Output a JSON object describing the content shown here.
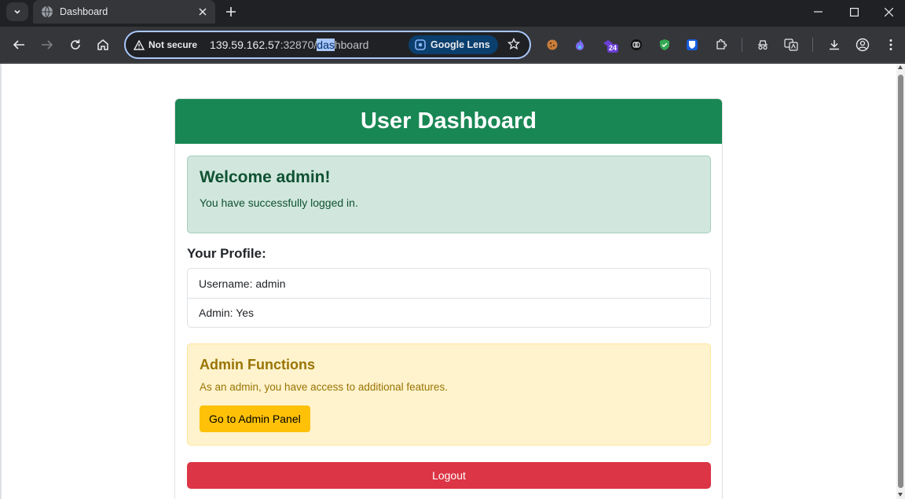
{
  "browser": {
    "tab_title": "Dashboard",
    "omnibox": {
      "security_label": "Not secure",
      "url_host": "139.59.162.57",
      "url_port": ":32870/",
      "url_selected": "das",
      "url_rest": "hboard",
      "lens_label": "Google Lens"
    },
    "extension_badge": "24"
  },
  "page": {
    "header_title": "User Dashboard",
    "welcome": {
      "heading": "Welcome admin!",
      "message": "You have successfully logged in."
    },
    "profile": {
      "title": "Your Profile:",
      "items": [
        {
          "label": "Username: admin"
        },
        {
          "label": "Admin: Yes"
        }
      ]
    },
    "admin": {
      "heading": "Admin Functions",
      "message": "As an admin, you have access to additional features.",
      "button_label": "Go to Admin Panel"
    },
    "logout_label": "Logout"
  },
  "colors": {
    "header_green": "#198754",
    "success_bg": "#d1e7dd",
    "warning_bg": "#fff3cd",
    "admin_button": "#ffc107",
    "logout_button": "#dc3545"
  },
  "icons": [
    "tab-search-icon",
    "globe-icon",
    "close-icon",
    "plus-icon",
    "minimize-icon",
    "maximize-icon",
    "window-close-icon",
    "back-arrow-icon",
    "forward-arrow-icon",
    "reload-icon",
    "home-icon",
    "warning-triangle-icon",
    "lens-icon",
    "bookmark-star-icon",
    "cookie-icon",
    "extension-icons",
    "puzzle-icon",
    "download-icon",
    "profile-icon",
    "more-menu-icon"
  ]
}
